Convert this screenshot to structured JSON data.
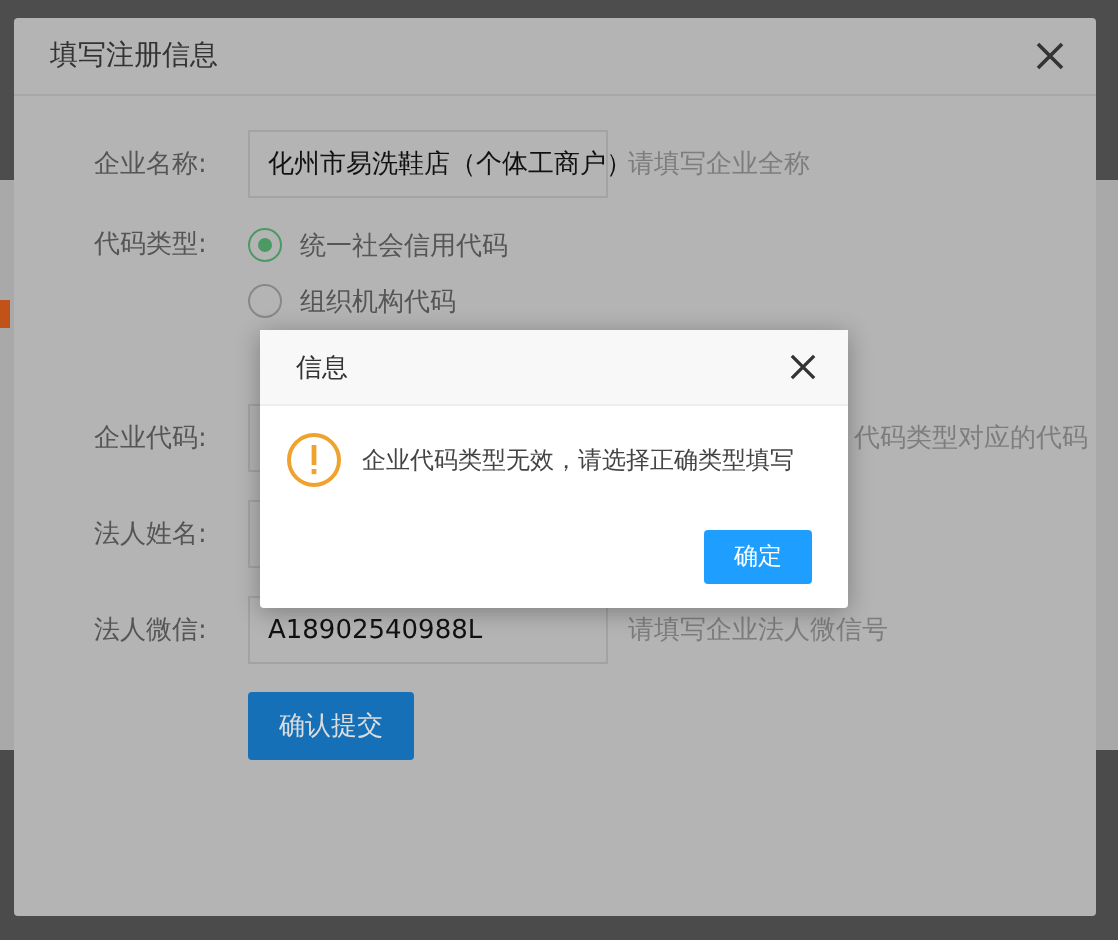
{
  "modal": {
    "title": "填写注册信息",
    "fields": [
      {
        "kind": "input",
        "label": "企业名称:",
        "value": "化州市易洗鞋店（个体工商户）",
        "hint": "请填写企业全称"
      },
      {
        "kind": "radio",
        "label": "代码类型:",
        "options": [
          {
            "label": "统一社会信用代码",
            "selected": true
          },
          {
            "label": "组织机构代码",
            "selected": false
          }
        ]
      },
      {
        "kind": "input",
        "label": "企业代码:",
        "hint": "代码类型对应的代码"
      },
      {
        "kind": "input",
        "label": "法人姓名:"
      },
      {
        "kind": "input",
        "label": "法人微信:",
        "value": "A18902540988L",
        "hint": "请填写企业法人微信号"
      }
    ],
    "submit": "确认提交"
  },
  "alert": {
    "title": "信息",
    "message": "企业代码类型无效，请选择正确类型填写",
    "button": "确定"
  }
}
